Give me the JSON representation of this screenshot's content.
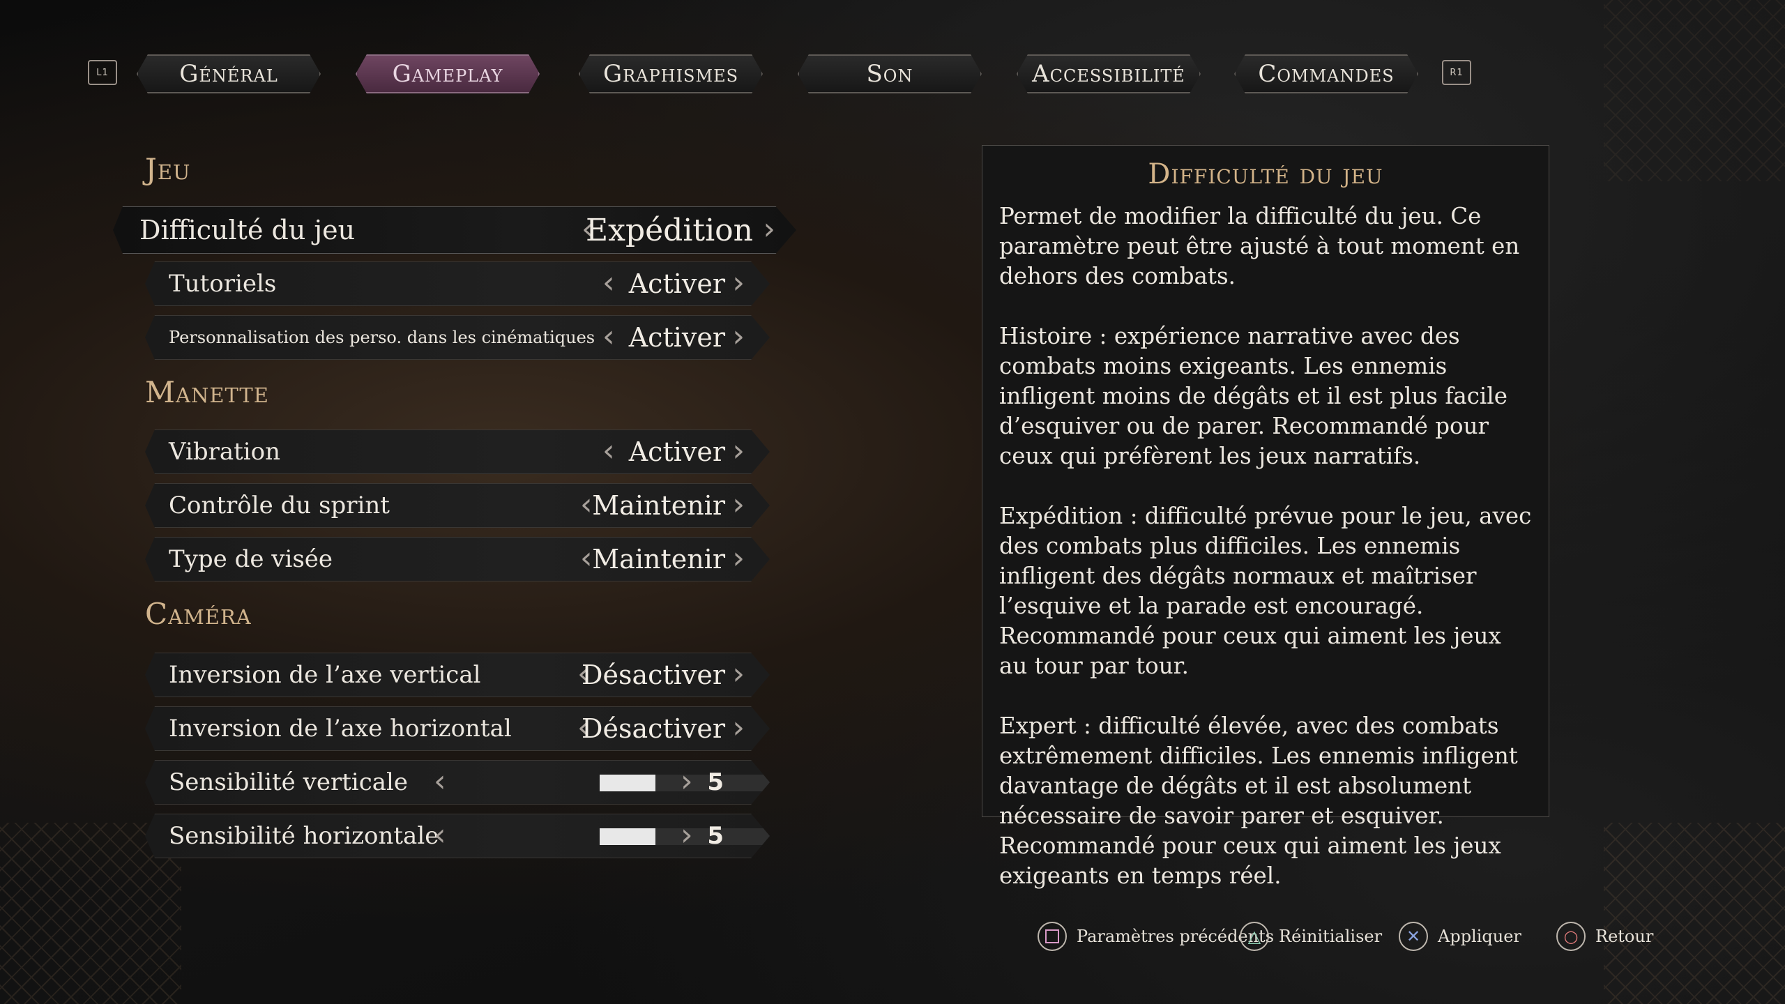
{
  "tabs": {
    "left_shoulder": "L1",
    "right_shoulder": "R1",
    "items": [
      {
        "label": "Général"
      },
      {
        "label": "Gameplay",
        "active": true
      },
      {
        "label": "Graphismes"
      },
      {
        "label": "Son"
      },
      {
        "label": "Accessibilité"
      },
      {
        "label": "Commandes"
      }
    ]
  },
  "sections": {
    "jeu": "Jeu",
    "manette": "Manette",
    "camera": "Caméra"
  },
  "settings": {
    "difficulty": {
      "label": "Difficulté du jeu",
      "value": "Expédition"
    },
    "tutorials": {
      "label": "Tutoriels",
      "value": "Activer"
    },
    "customization": {
      "label": "Personnalisation des perso. dans les cinématiques",
      "value": "Activer"
    },
    "vibration": {
      "label": "Vibration",
      "value": "Activer"
    },
    "sprint": {
      "label": "Contrôle du sprint",
      "value": "Maintenir"
    },
    "aim": {
      "label": "Type de visée",
      "value": "Maintenir"
    },
    "invert_v": {
      "label": "Inversion de l’axe vertical",
      "value": "Désactiver"
    },
    "invert_h": {
      "label": "Inversion de l’axe horizontal",
      "value": "Désactiver"
    },
    "sens_v": {
      "label": "Sensibilité verticale",
      "value": "5",
      "fraction": 0.25
    },
    "sens_h": {
      "label": "Sensibilité horizontale",
      "value": "5",
      "fraction": 0.25
    }
  },
  "description": {
    "title": "Difficulté du jeu",
    "paragraphs": [
      "Permet de modifier la difficulté du jeu. Ce paramètre peut être ajusté à tout moment en dehors des combats.",
      "Histoire : expérience narrative avec des combats moins exigeants. Les ennemis infligent moins de dégâts et il est plus facile d’esquiver ou de parer. Recommandé pour ceux qui préfèrent les jeux narratifs.",
      "Expédition : difficulté prévue pour le jeu, avec des combats plus difficiles. Les ennemis infligent des dégâts normaux et maîtriser l’esquive et la parade est encouragé. Recommandé pour ceux qui aiment les jeux au tour par tour.",
      "Expert : difficulté élevée, avec des combats extrêmement difficiles. Les ennemis infligent davantage de dégâts et il est absolument nécessaire de savoir parer et esquiver. Recommandé pour ceux qui aiment les jeux exigeants en temps réel."
    ]
  },
  "footer": {
    "previous": {
      "label": "Paramètres précédents",
      "icon": "square-button-icon"
    },
    "reset": {
      "label": "Réinitialiser",
      "icon": "triangle-button-icon"
    },
    "apply": {
      "label": "Appliquer",
      "icon": "cross-button-icon"
    },
    "back": {
      "label": "Retour",
      "icon": "circle-button-icon"
    }
  },
  "colors": {
    "accent_gold": "#d1b48d",
    "active_tab": "#6e4560",
    "triangle_icon": "#8fd0b4",
    "cross_icon": "#8aa3e0",
    "circle_icon": "#e07a7a",
    "square_icon": "#d99ac8"
  }
}
